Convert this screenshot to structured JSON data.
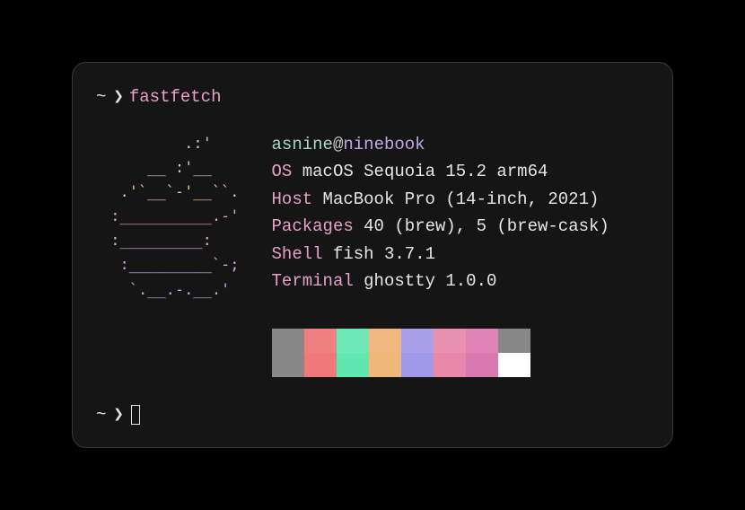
{
  "prompt": {
    "tilde": "~",
    "arrow": "❯",
    "command": "fastfetch"
  },
  "ascii": {
    "l1": "         .:'",
    "l2": "     __ :'__",
    "l3": "  .'`__`-'__``.",
    "l4": " :__________.-'",
    "l5": " :_________:",
    "l6": "  :_________`-;",
    "l7": "   `.__.-.__.'",
    "l8": ""
  },
  "userhost": {
    "user": "asnine",
    "at": "@",
    "host": "ninebook"
  },
  "info": {
    "os": {
      "label": "OS",
      "value": " macOS Sequoia 15.2 arm64"
    },
    "host": {
      "label": "Host",
      "value": " MacBook Pro (14-inch, 2021)"
    },
    "packages": {
      "label": "Packages",
      "value": " 40 (brew), 5 (brew-cask)"
    },
    "shell": {
      "label": "Shell",
      "value": " fish 3.7.1"
    },
    "terminal": {
      "label": "Terminal",
      "value": " ghostty 1.0.0"
    }
  },
  "swatches": {
    "row1": [
      "#878787",
      "#f08080",
      "#6ee8b5",
      "#f0b880",
      "#a8a0e8",
      "#e890b0",
      "#e083b8",
      "#878787"
    ],
    "row2": [
      "#878787",
      "#f07878",
      "#60e8b0",
      "#f0b878",
      "#a098e8",
      "#e888a8",
      "#d878b0",
      "#ffffff"
    ]
  }
}
